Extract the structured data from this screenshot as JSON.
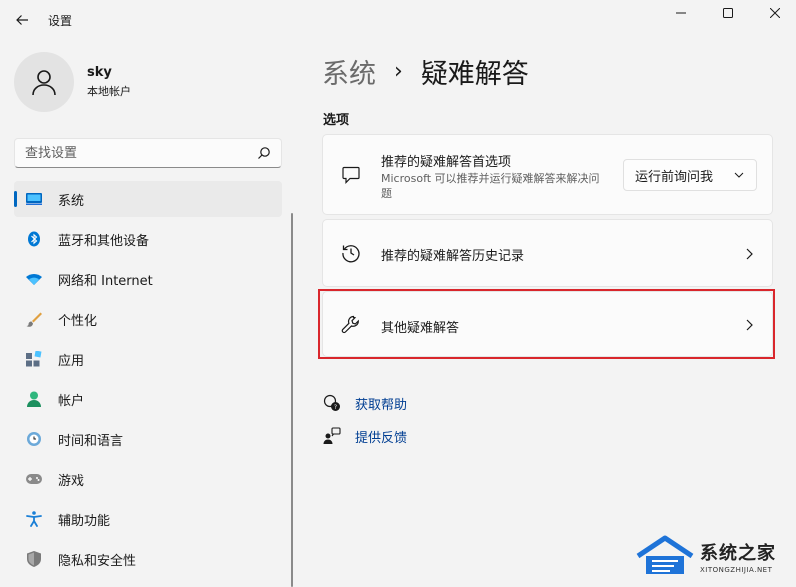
{
  "window": {
    "title": "设置"
  },
  "profile": {
    "name": "sky",
    "account_type": "本地帐户"
  },
  "search": {
    "placeholder": "查找设置"
  },
  "sidebar": {
    "items": [
      {
        "label": "系统",
        "icon": "system-icon",
        "active": true
      },
      {
        "label": "蓝牙和其他设备",
        "icon": "bluetooth-icon"
      },
      {
        "label": "网络和 Internet",
        "icon": "wifi-icon"
      },
      {
        "label": "个性化",
        "icon": "brush-icon"
      },
      {
        "label": "应用",
        "icon": "apps-icon"
      },
      {
        "label": "帐户",
        "icon": "person-icon"
      },
      {
        "label": "时间和语言",
        "icon": "clock-globe-icon"
      },
      {
        "label": "游戏",
        "icon": "gamepad-icon"
      },
      {
        "label": "辅助功能",
        "icon": "accessibility-icon"
      },
      {
        "label": "隐私和安全性",
        "icon": "shield-icon"
      }
    ]
  },
  "breadcrumb": {
    "parent": "系统",
    "separator": "›",
    "current": "疑难解答"
  },
  "options": {
    "title": "选项",
    "cards": [
      {
        "title": "推荐的疑难解答首选项",
        "description": "Microsoft 可以推荐并运行疑难解答来解决问题",
        "dropdown_value": "运行前询问我",
        "icon": "chat-bubble-icon"
      },
      {
        "title": "推荐的疑难解答历史记录",
        "icon": "history-icon"
      },
      {
        "title": "其他疑难解答",
        "icon": "wrench-icon",
        "highlighted": true
      }
    ]
  },
  "help": {
    "get_help": "获取帮助",
    "feedback": "提供反馈"
  },
  "watermark": {
    "title": "系统之家",
    "url": "XITONGZHIJIA.NET"
  },
  "colors": {
    "accent": "#0067c0",
    "link": "#003e92",
    "highlight": "#d9262c"
  }
}
